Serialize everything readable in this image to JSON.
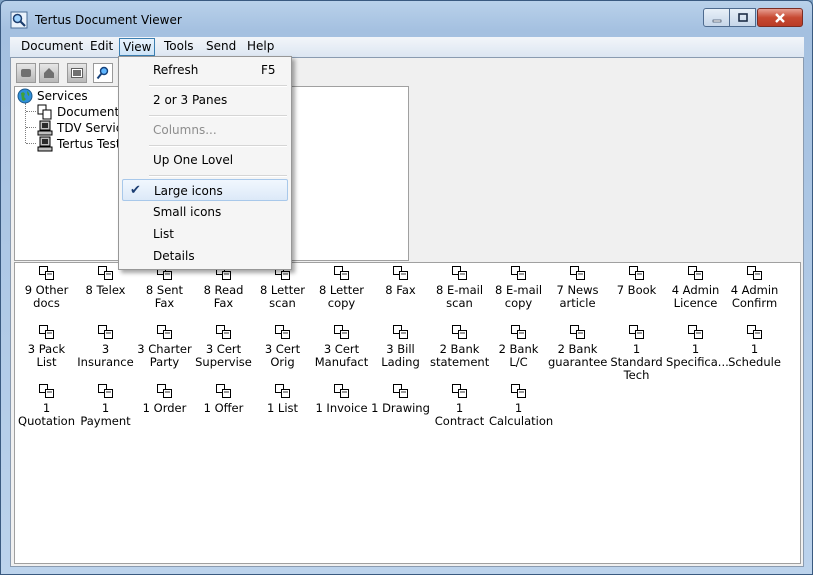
{
  "window": {
    "title": "Tertus Document Viewer"
  },
  "menubar": [
    "Document",
    "Edit",
    "View",
    "Tools",
    "Send",
    "Help"
  ],
  "toolbar": [
    "back-icon",
    "home-icon",
    "panes-icon",
    "search-icon"
  ],
  "tree": {
    "root": "Services",
    "children": [
      "Document Ty",
      "TDV Service",
      "Tertus Test S"
    ]
  },
  "view_menu": {
    "refresh": "Refresh",
    "refresh_shortcut": "F5",
    "panes": "2 or 3 Panes",
    "columns": "Columns...",
    "up_one_level": "Up One Lovel",
    "large_icons": "Large icons",
    "small_icons": "Small icons",
    "list": "List",
    "details": "Details",
    "checked_item": "Large icons"
  },
  "documents": [
    [
      "9 Other",
      "docs"
    ],
    [
      "8 Telex"
    ],
    [
      "8 Sent Fax"
    ],
    [
      "8 Read Fax"
    ],
    [
      "8 Letter",
      "scan"
    ],
    [
      "8 Letter",
      "copy"
    ],
    [
      "8 Fax"
    ],
    [
      "8 E-mail",
      "scan"
    ],
    [
      "8 E-mail",
      "copy"
    ],
    [
      "7 News",
      "article"
    ],
    [
      "7 Book"
    ],
    [
      "4 Admin",
      "Licence"
    ],
    [
      "4 Admin",
      "Confirm"
    ],
    [
      "3 Pack List"
    ],
    [
      "3",
      "Insurance"
    ],
    [
      "3 Charter",
      "Party"
    ],
    [
      "3 Cert",
      "Supervise"
    ],
    [
      "3 Cert Orig"
    ],
    [
      "3 Cert",
      "Manufact"
    ],
    [
      "3 Bill",
      "Lading"
    ],
    [
      "2 Bank",
      "statement"
    ],
    [
      "2 Bank L/C"
    ],
    [
      "2 Bank",
      "guarantee"
    ],
    [
      "1 Standard",
      "Tech"
    ],
    [
      "1",
      "Specifica..."
    ],
    [
      "1 Schedule"
    ],
    [
      "1 Quotation"
    ],
    [
      "1 Payment"
    ],
    [
      "1 Order"
    ],
    [
      "1 Offer"
    ],
    [
      "1 List"
    ],
    [
      "1 Invoice"
    ],
    [
      "1 Drawing"
    ],
    [
      "1 Contract"
    ],
    [
      "1",
      "Calculation"
    ]
  ]
}
